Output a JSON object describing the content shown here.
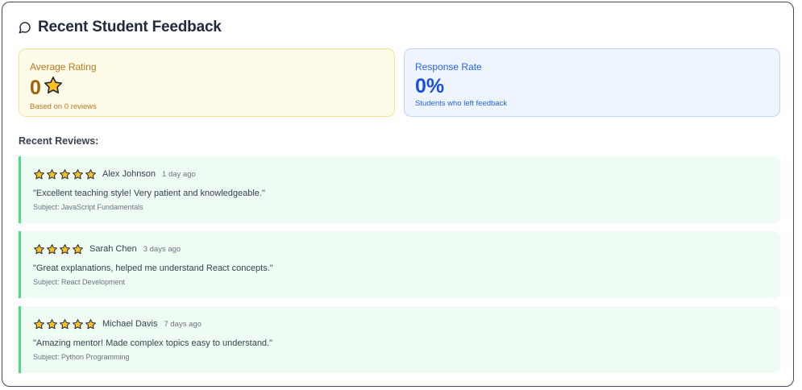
{
  "header": {
    "title": "Recent Student Feedback",
    "icon": "chat-bubble-icon"
  },
  "stats": {
    "average_rating": {
      "label": "Average Rating",
      "value": "0",
      "icon": "star-icon",
      "sub": "Based on 0 reviews"
    },
    "response_rate": {
      "label": "Response Rate",
      "value": "0%",
      "sub": "Students who left feedback"
    }
  },
  "reviews_section": {
    "title": "Recent Reviews:"
  },
  "reviews": [
    {
      "rating": 5,
      "name": "Alex Johnson",
      "time": "1 day ago",
      "comment": "\"Excellent teaching style! Very patient and knowledgeable.\"",
      "subject": "Subject: JavaScript Fundamentals"
    },
    {
      "rating": 4,
      "name": "Sarah Chen",
      "time": "3 days ago",
      "comment": "\"Great explanations, helped me understand React concepts.\"",
      "subject": "Subject: React Development"
    },
    {
      "rating": 5,
      "name": "Michael Davis",
      "time": "7 days ago",
      "comment": "\"Amazing mentor! Made complex topics easy to understand.\"",
      "subject": "Subject: Python Programming"
    }
  ],
  "colors": {
    "star_fill": "#fbbf24",
    "star_stroke": "#1f2937",
    "rating_accent": "#a16207",
    "response_accent": "#1d4ed8",
    "review_border": "#4ade80"
  }
}
